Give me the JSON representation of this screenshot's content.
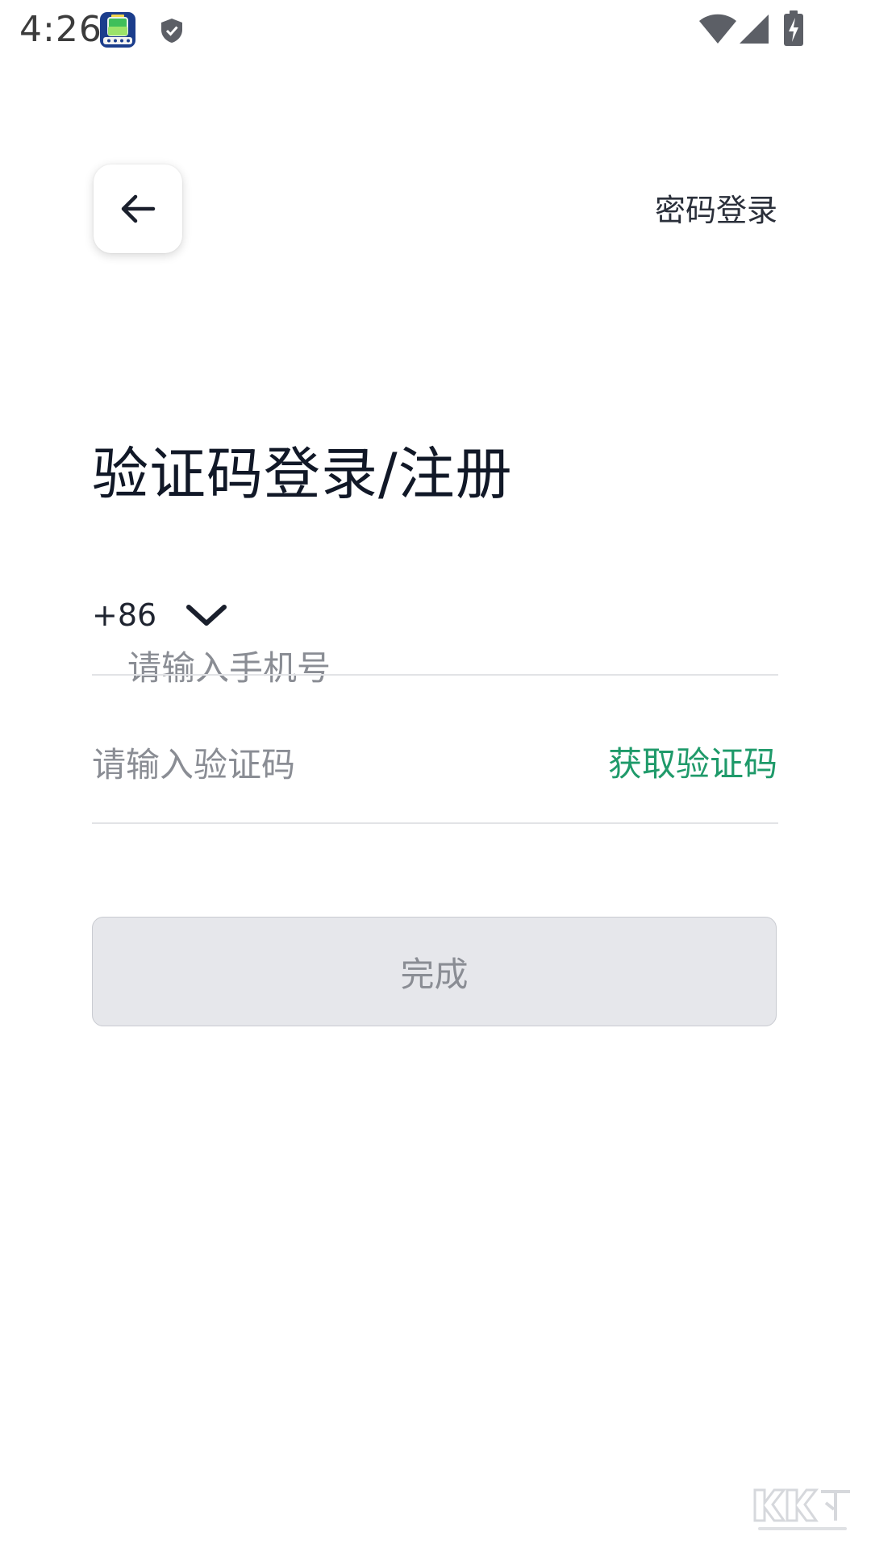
{
  "status_bar": {
    "time": "4:26",
    "icons": [
      "app-icon",
      "shield-icon",
      "wifi-icon",
      "signal-icon",
      "battery-charging-icon"
    ]
  },
  "header": {
    "back_icon": "arrow-left-icon",
    "password_login_label": "密码登录"
  },
  "title": "验证码登录/注册",
  "phone": {
    "country_code": "+86",
    "chevron_icon": "chevron-down-icon",
    "placeholder": "请输入手机号",
    "value": ""
  },
  "verification": {
    "placeholder": "请输入验证码",
    "value": "",
    "get_code_label": "获取验证码"
  },
  "submit": {
    "label": "完成",
    "enabled": false
  },
  "colors": {
    "accent": "#1f9a6a",
    "title": "#111827",
    "placeholder": "#8a8d94",
    "divider": "#e2e3e6",
    "button_disabled_bg": "#e6e7eb"
  }
}
